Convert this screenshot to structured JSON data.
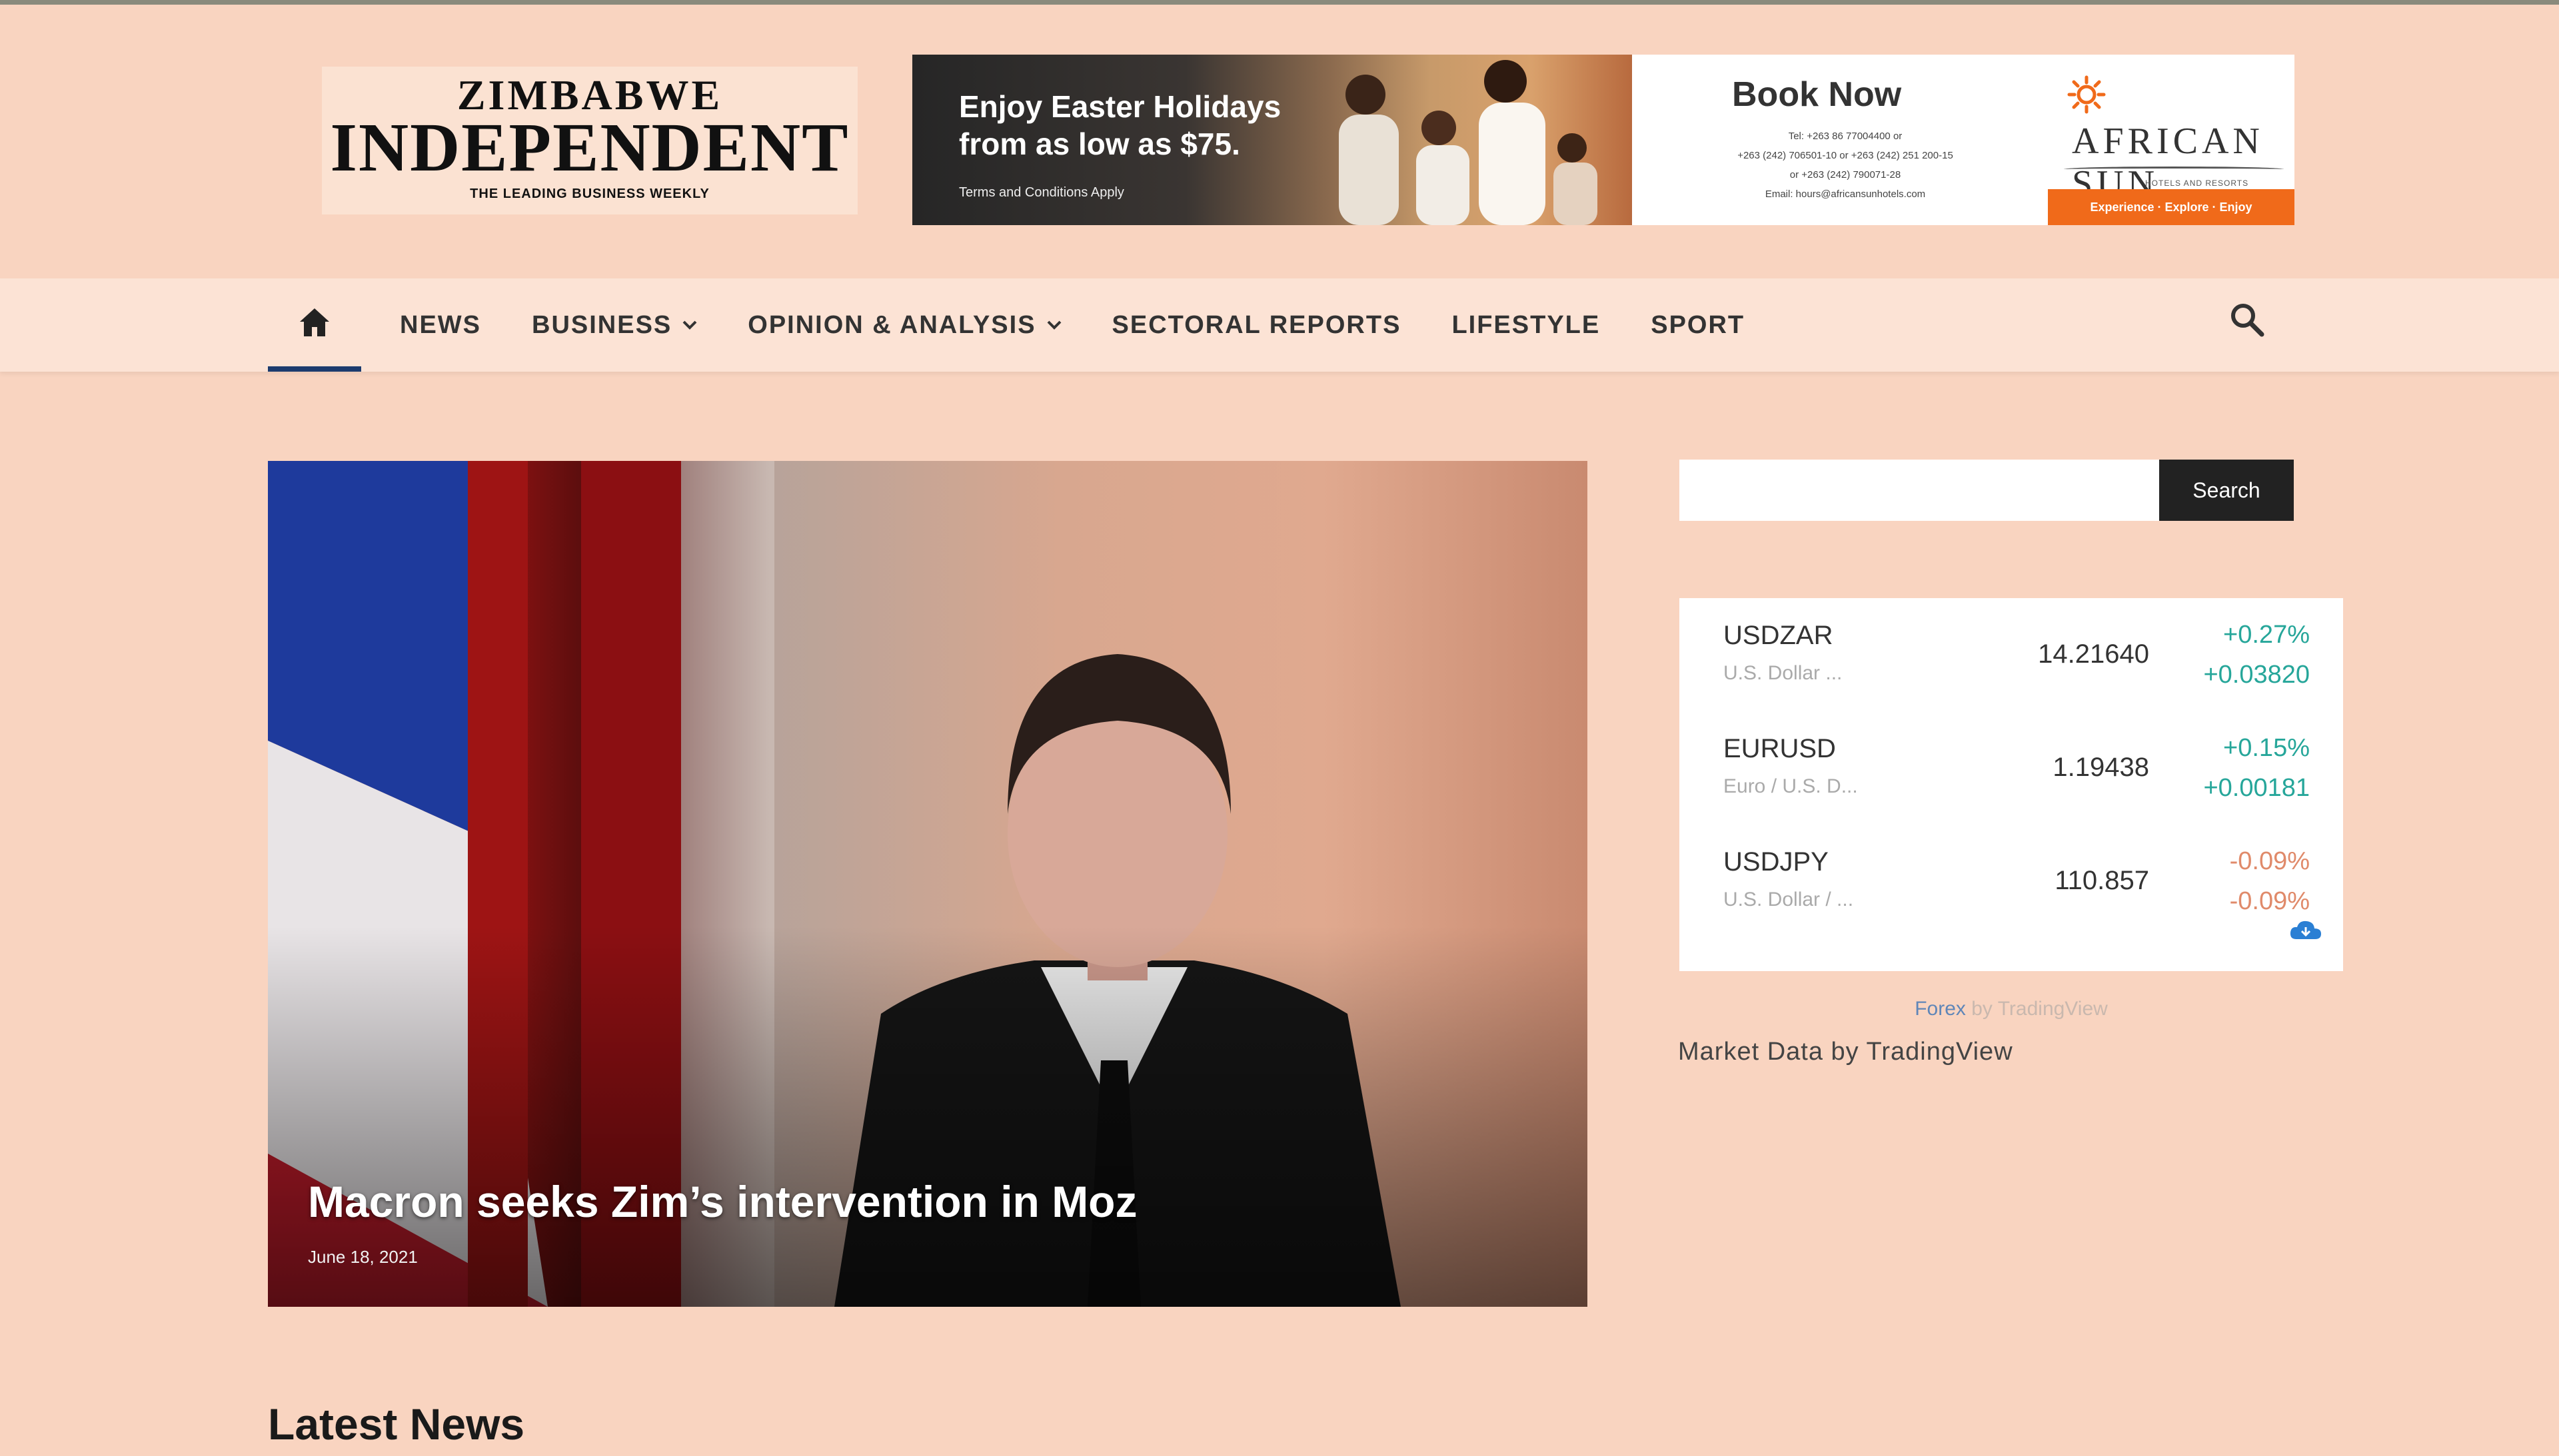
{
  "logo": {
    "line1": "ZIMBABWE",
    "line2": "INDEPENDENT",
    "tagline": "THE LEADING BUSINESS WEEKLY"
  },
  "ad": {
    "headline_line1": "Enjoy Easter Holidays",
    "headline_line2": "from as low as $75.",
    "terms": "Terms and Conditions Apply",
    "book_now": "Book Now",
    "contact_line1": "Tel: +263 86 77004400 or",
    "contact_line2": "+263 (242) 706501-10 or +263 (242) 251 200-15",
    "contact_line3": "or +263 (242) 790071-28",
    "contact_line4": "Email: hours@africansunhotels.com",
    "brand_name": "AFRICAN SUN",
    "brand_tagline": "HOTELS AND RESORTS",
    "brand_strip": "Experience · Explore · Enjoy"
  },
  "nav": {
    "items": [
      {
        "label": "NEWS"
      },
      {
        "label": "BUSINESS"
      },
      {
        "label": "OPINION & ANALYSIS"
      },
      {
        "label": "SECTORAL REPORTS"
      },
      {
        "label": "LIFESTYLE"
      },
      {
        "label": "SPORT"
      }
    ],
    "active_color": "#1c3b6e"
  },
  "hero": {
    "title": "Macron seeks Zim’s intervention in Moz",
    "date": "June 18, 2021"
  },
  "sidebar": {
    "search_placeholder": "",
    "search_button": "Search"
  },
  "forex": {
    "rows": [
      {
        "symbol": "USDZAR",
        "desc": "U.S. Dollar ...",
        "price": "14.21640",
        "pct": "+0.27%",
        "change": "+0.03820",
        "trend": "up"
      },
      {
        "symbol": "EURUSD",
        "desc": "Euro / U.S. D...",
        "price": "1.19438",
        "pct": "+0.15%",
        "change": "+0.00181",
        "trend": "up"
      },
      {
        "symbol": "USDJPY",
        "desc": "U.S. Dollar / ...",
        "price": "110.857",
        "pct": "-0.09%",
        "change": "-0.09%",
        "trend": "down"
      }
    ],
    "credit_link": "Forex",
    "credit_rest": " by TradingView",
    "market_data": "Market Data by TradingView"
  },
  "sections": {
    "latest_news": "Latest News"
  }
}
